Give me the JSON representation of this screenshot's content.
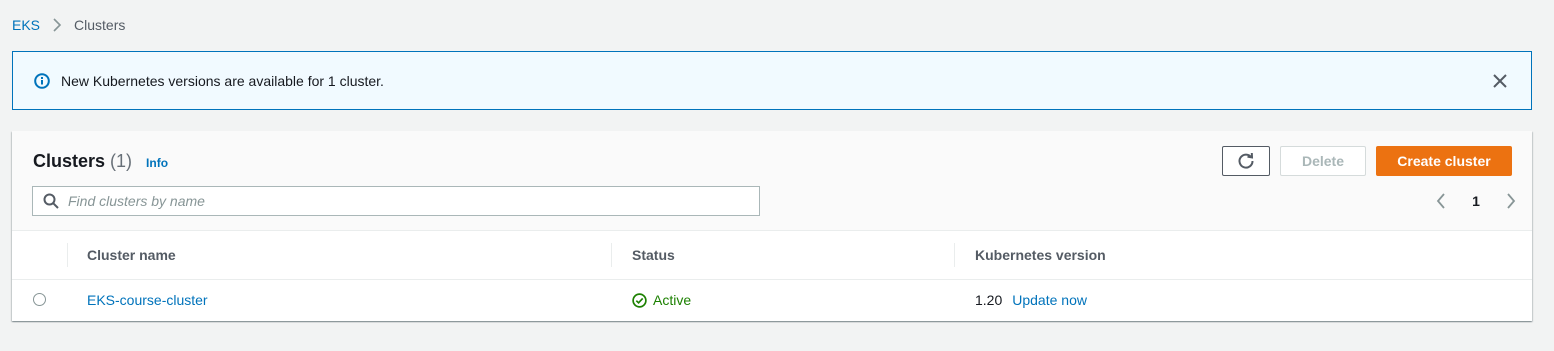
{
  "breadcrumb": {
    "root": "EKS",
    "current": "Clusters"
  },
  "flash": {
    "message": "New Kubernetes versions are available for 1 cluster.",
    "icon": "info-icon"
  },
  "panel": {
    "title": "Clusters",
    "count": "(1)",
    "info_label": "Info",
    "buttons": {
      "refresh_icon": "refresh-icon",
      "delete_label": "Delete",
      "create_label": "Create cluster"
    },
    "search": {
      "placeholder": "Find clusters by name",
      "value": ""
    },
    "pagination": {
      "current_page": "1"
    },
    "table": {
      "columns": [
        "Cluster name",
        "Status",
        "Kubernetes version"
      ],
      "rows": [
        {
          "name": "EKS-course-cluster",
          "status": "Active",
          "version": "1.20",
          "version_action": "Update now"
        }
      ]
    }
  },
  "colors": {
    "link": "#0073bb",
    "primary": "#ec7211",
    "success": "#1d8102",
    "background": "#f2f3f3"
  }
}
